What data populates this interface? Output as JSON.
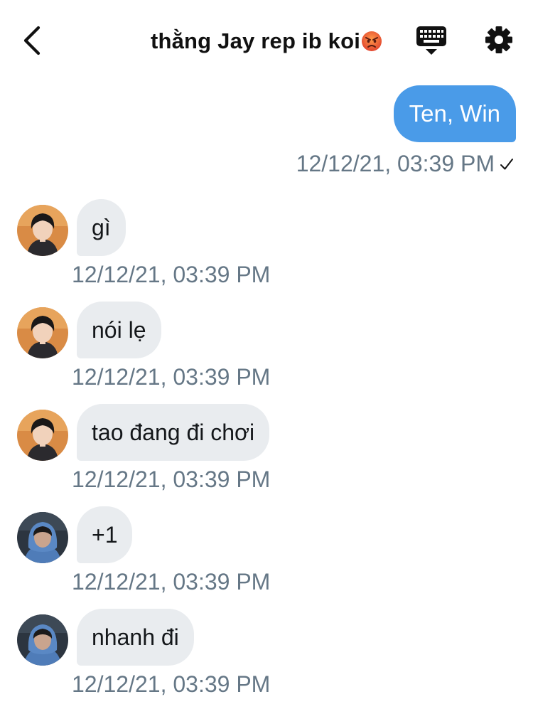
{
  "header": {
    "title": "thằng Jay rep ib koi",
    "title_emoji": "angry-face-icon"
  },
  "sent_message": {
    "text": "Ten, Win",
    "timestamp": "12/12/21, 03:39 PM",
    "status_icon": "checkmark-icon"
  },
  "messages": [
    {
      "text": "gì",
      "timestamp": "12/12/21, 03:39 PM",
      "avatar": "user-jay"
    },
    {
      "text": "nói lẹ",
      "timestamp": "12/12/21, 03:39 PM",
      "avatar": "user-jay"
    },
    {
      "text": "tao đang đi chơi",
      "timestamp": "12/12/21, 03:39 PM",
      "avatar": "user-jay"
    },
    {
      "text": "+1",
      "timestamp": "12/12/21, 03:39 PM",
      "avatar": "user-hood"
    },
    {
      "text": "nhanh đi",
      "timestamp": "12/12/21, 03:39 PM",
      "avatar": "user-hood"
    }
  ],
  "colors": {
    "sent_bubble": "#4a9be8",
    "received_bubble": "#e9ecef",
    "timestamp": "#657786"
  }
}
